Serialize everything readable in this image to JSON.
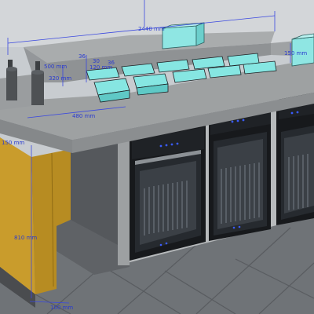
{
  "scene": {
    "colors": {
      "sky": "#c8ccd0",
      "floor": "#6f7377",
      "floor_tile_line": "#5a5d61",
      "concrete": "#9c9fa0",
      "concrete_dark": "#7e8183",
      "wood": "#c79a2a",
      "wood_dark": "#a17a1e",
      "steel": "#b9bcbe",
      "glass": "#7fe3e0",
      "door_black": "#15171a",
      "led_blue": "#3a5cff",
      "dimension": "#2a3bd0"
    },
    "dimensions": {
      "overall_width": "2440 mm",
      "left_500": "500 mm",
      "left_36": "36",
      "top_30": "30",
      "mid_36": "36",
      "bin_120": "120 mm",
      "left_320": "320 mm",
      "depth_480": "480 mm",
      "right_150": "150 mm",
      "side_150": "150 mm",
      "height_810": "810 mm",
      "base_100": "100 mm"
    }
  }
}
